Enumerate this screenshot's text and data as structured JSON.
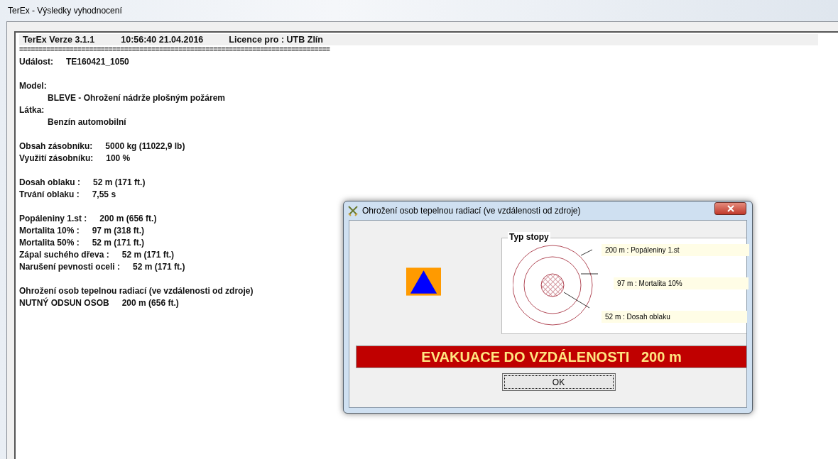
{
  "window": {
    "title": "TerEx - Výsledky vyhodnocení"
  },
  "report": {
    "header": [
      {
        "text": "TerEx  Verze 3.1.1"
      },
      {
        "text": "10:56:40  21.04.2016"
      },
      {
        "text": "Licence pro : UTB Zlín"
      }
    ],
    "separator": "================================================================================",
    "sections": [
      {
        "lines": [
          {
            "kind": "pair",
            "label": "Událost:",
            "value": "TE160421_1050"
          }
        ]
      },
      {
        "lines": [
          {
            "kind": "heading",
            "label": "Model:"
          },
          {
            "kind": "indent",
            "label": "BLEVE - Ohrožení nádrže plošným požárem"
          },
          {
            "kind": "heading",
            "label": "Látka:"
          },
          {
            "kind": "indent",
            "label": "Benzín automobilní"
          }
        ]
      },
      {
        "lines": [
          {
            "kind": "pair",
            "label": "Obsah zásobníku:",
            "value": "5000 kg (11022,9 lb)"
          },
          {
            "kind": "pair",
            "label": "Využití zásobníku:",
            "value": "100 %"
          }
        ]
      },
      {
        "lines": [
          {
            "kind": "pair",
            "label": "Dosah oblaku :",
            "value": "52 m (171 ft.)"
          },
          {
            "kind": "pair",
            "label": "Trvání oblaku :",
            "value": "7,55 s"
          }
        ]
      },
      {
        "lines": [
          {
            "kind": "pair",
            "label": "Popáleniny 1.st :",
            "value": "200 m (656 ft.)"
          },
          {
            "kind": "pair",
            "label": "Mortalita 10% :",
            "value": "97 m (318 ft.)"
          },
          {
            "kind": "pair",
            "label": "Mortalita 50% :",
            "value": "52 m (171 ft.)"
          },
          {
            "kind": "pair",
            "label": "Zápal suchého dřeva :",
            "value": "52 m (171 ft.)"
          },
          {
            "kind": "pair",
            "label": "Narušení pevnosti oceli :",
            "value": "52 m (171 ft.)"
          }
        ]
      },
      {
        "lines": [
          {
            "kind": "heading",
            "label": "Ohrožení osob tepelnou radiací (ve vzdálenosti od zdroje)"
          },
          {
            "kind": "pair",
            "label": "NUTNÝ ODSUN OSOB",
            "value": "200 m (656 ft.)"
          }
        ]
      }
    ]
  },
  "dialog": {
    "title": "Ohrožení osob tepelnou radiací (ve vzdálenosti od zdroje)",
    "group_title": "Typ stopy",
    "zones": [
      {
        "label": "200 m : Popáleniny 1.st"
      },
      {
        "label": "97 m : Mortalita 10%"
      },
      {
        "label": "52 m : Dosah oblaku"
      }
    ],
    "banner": "EVAKUACE DO VZDÁLENOSTI   200 m",
    "buttons": [
      "OK"
    ]
  }
}
